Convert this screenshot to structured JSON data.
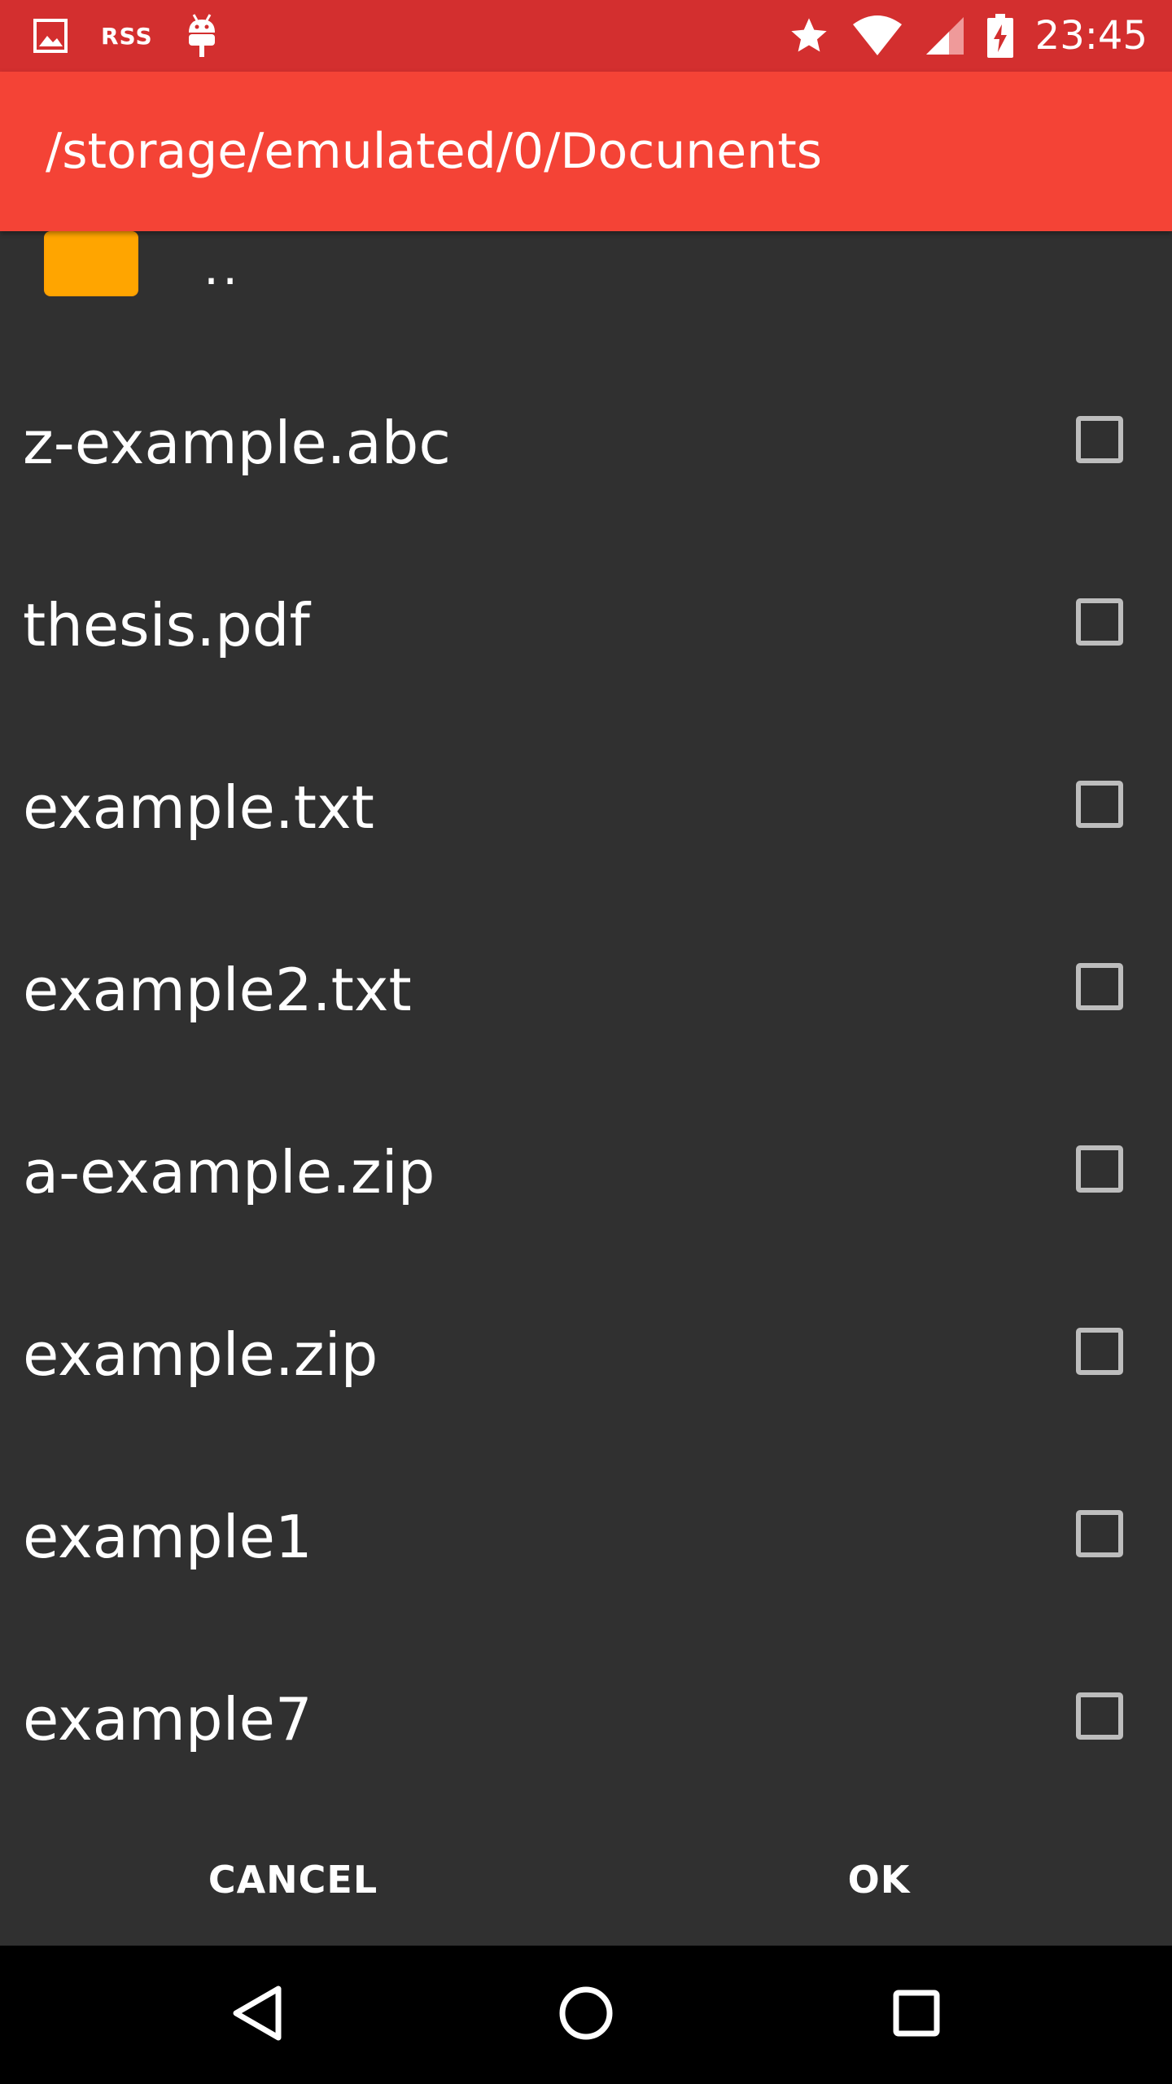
{
  "status_bar": {
    "left_icons": [
      "image-icon",
      "rss-icon",
      "android-debug-icon"
    ],
    "rss_label": "RSS",
    "right_icons": [
      "star-icon",
      "wifi-icon",
      "cell-signal-icon",
      "battery-charging-icon"
    ],
    "time": "23:45"
  },
  "app_bar": {
    "title": "/storage/emulated/0/Docunents"
  },
  "file_list": {
    "parent": {
      "icon": "folder-icon",
      "label": ".."
    },
    "items": [
      {
        "name": "z-example.abc",
        "checked": false
      },
      {
        "name": "thesis.pdf",
        "checked": false
      },
      {
        "name": "example.txt",
        "checked": false
      },
      {
        "name": "example2.txt",
        "checked": false
      },
      {
        "name": "a-example.zip",
        "checked": false
      },
      {
        "name": "example.zip",
        "checked": false
      },
      {
        "name": "example1",
        "checked": false
      },
      {
        "name": "example7",
        "checked": false
      }
    ]
  },
  "actions": {
    "cancel_label": "CANCEL",
    "ok_label": "OK"
  },
  "nav_bar": {
    "icons": [
      "back-icon",
      "home-icon",
      "recents-icon"
    ]
  },
  "colors": {
    "status_bar": "#d32f2f",
    "app_bar": "#f44336",
    "background": "#303030",
    "folder": "#ffa000"
  }
}
